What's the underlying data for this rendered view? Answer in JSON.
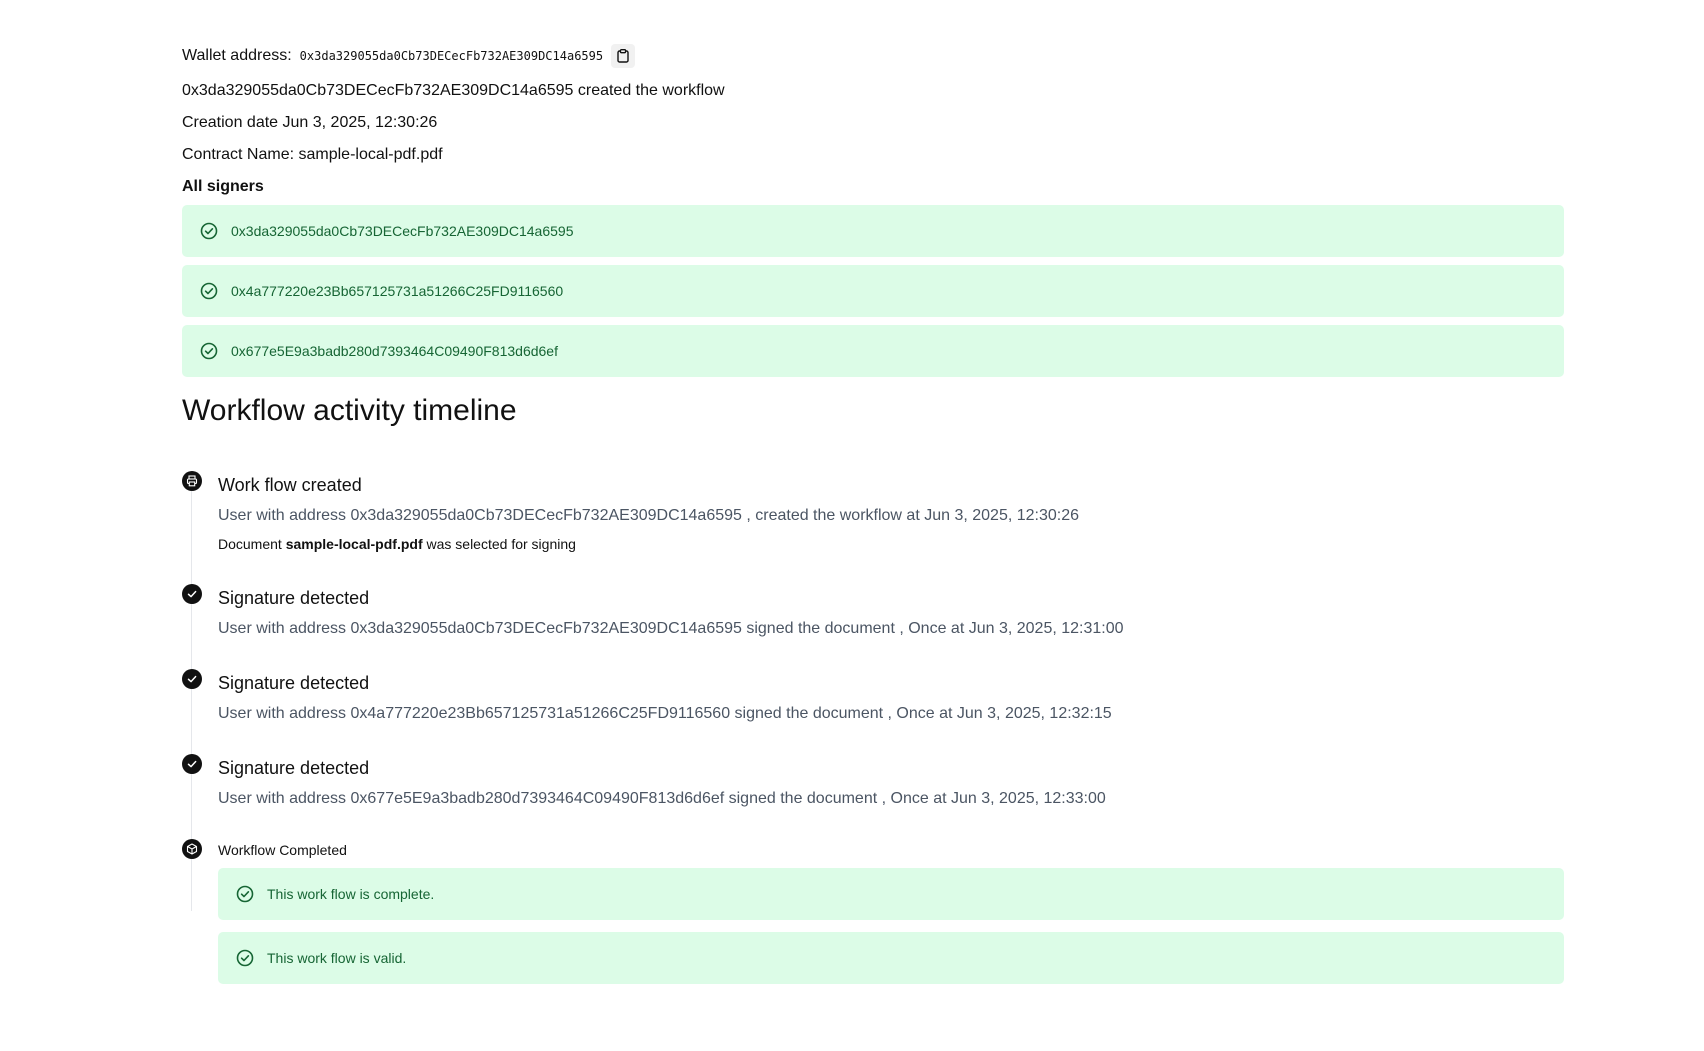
{
  "wallet": {
    "label": "Wallet address:",
    "address": "0x3da329055da0Cb73DECecFb732AE309DC14a6595"
  },
  "info": {
    "created_line": "0x3da329055da0Cb73DECecFb732AE309DC14a6595 created the workflow",
    "creation_date": "Creation date Jun 3, 2025, 12:30:26",
    "contract_name": "Contract Name: sample-local-pdf.pdf"
  },
  "signers": {
    "title": "All signers",
    "items": [
      "0x3da329055da0Cb73DECecFb732AE309DC14a6595",
      "0x4a777220e23Bb657125731a51266C25FD9116560",
      "0x677e5E9a3badb280d7393464C09490F813d6d6ef"
    ]
  },
  "timeline": {
    "title": "Workflow activity timeline",
    "created": {
      "heading": "Work flow created",
      "description": "User with address 0x3da329055da0Cb73DECecFb732AE309DC14a6595 , created the workflow at  Jun 3, 2025, 12:30:26",
      "doc_prefix": "Document ",
      "doc_name": "sample-local-pdf.pdf",
      "doc_suffix": " was selected for signing"
    },
    "signatures": [
      {
        "heading": "Signature detected",
        "description": "User with address 0x3da329055da0Cb73DECecFb732AE309DC14a6595   signed the document ,  Once  at Jun 3, 2025, 12:31:00"
      },
      {
        "heading": "Signature detected",
        "description": "User with address 0x4a777220e23Bb657125731a51266C25FD9116560   signed the document ,  Once  at Jun 3, 2025, 12:32:15"
      },
      {
        "heading": "Signature detected",
        "description": "User with address 0x677e5E9a3badb280d7393464C09490F813d6d6ef   signed the document ,  Once  at Jun 3, 2025, 12:33:00"
      }
    ],
    "completed": {
      "heading": "Workflow Completed",
      "alerts": [
        "This work flow is complete.",
        "This work flow is valid."
      ]
    }
  },
  "colors": {
    "alert_bg": "#dcfce7",
    "alert_text": "#166534",
    "dot": "#111111",
    "muted_text": "#4b5563"
  },
  "icons": {
    "copy": "clipboard-icon",
    "signer": "check-circle-icon",
    "created": "printer-icon",
    "signature": "check-icon",
    "completed": "package-icon"
  }
}
